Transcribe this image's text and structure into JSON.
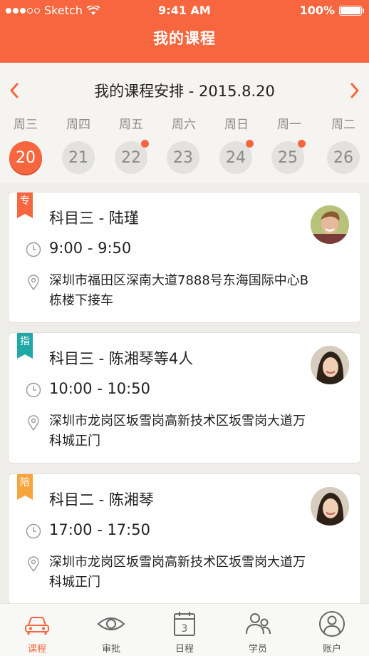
{
  "status_bar": {
    "carrier": "Sketch",
    "time": "9:41 AM",
    "battery": "100%"
  },
  "page_title": "我的课程",
  "schedule": {
    "title": "我的课程安排 - 2015.8.20",
    "weekdays": [
      "周三",
      "周四",
      "周五",
      "周六",
      "周日",
      "周一",
      "周二"
    ],
    "days": [
      {
        "num": "20",
        "active": true,
        "badge": false
      },
      {
        "num": "21",
        "active": false,
        "badge": false
      },
      {
        "num": "22",
        "active": false,
        "badge": true
      },
      {
        "num": "23",
        "active": false,
        "badge": false
      },
      {
        "num": "24",
        "active": false,
        "badge": true
      },
      {
        "num": "25",
        "active": false,
        "badge": true
      },
      {
        "num": "26",
        "active": false,
        "badge": false
      }
    ]
  },
  "courses": [
    {
      "tag": "专",
      "title": "科目三 - 陆瑾",
      "time": "9:00 - 9:50",
      "address_line1": "深圳市福田区深南大道7888号东海国际中心B",
      "address_line2": "栋楼下接车"
    },
    {
      "tag": "指",
      "title": "科目三 - 陈湘琴等4人",
      "time": "10:00 - 10:50",
      "address_line1": "深圳市龙岗区坂雪岗高新技术区坂雪岗大道万",
      "address_line2": "科城正门"
    },
    {
      "tag": "陪",
      "title": "科目二 - 陈湘琴",
      "time": "17:00 - 17:50",
      "address_line1": "深圳市龙岗区坂雪岗高新技术区坂雪岗大道万",
      "address_line2": "科城正门"
    }
  ],
  "tabs": [
    {
      "label": "课程",
      "icon": "car-icon"
    },
    {
      "label": "审批",
      "icon": "eye-icon"
    },
    {
      "label": "日程",
      "icon": "calendar-icon"
    },
    {
      "label": "学员",
      "icon": "students-icon"
    },
    {
      "label": "账户",
      "icon": "account-icon"
    }
  ],
  "calendar_icon_day": "3",
  "colors": {
    "accent": "#f7663f",
    "tag_teal": "#1fa9a6",
    "tag_amber": "#f5a53c"
  }
}
